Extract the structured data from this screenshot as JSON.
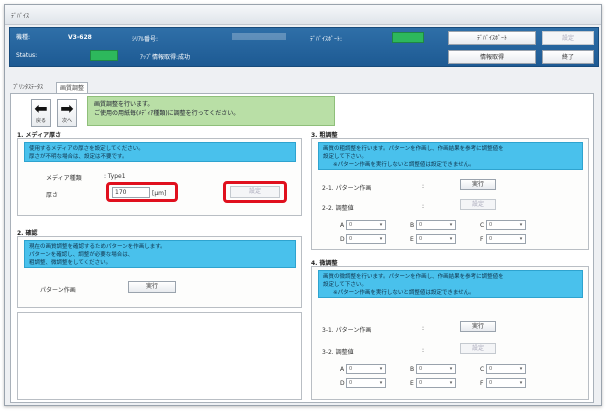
{
  "window": {
    "title": "ﾃﾞﾊﾞｲｽ"
  },
  "info": {
    "model_label": "機種:",
    "model_value": "V3-628",
    "serial_label": "ｼﾘｱﾙ番号:",
    "serial_value": "",
    "connection_label": "ﾃﾞﾊﾞｲｽﾎﾟｰﾄ:",
    "status_label": "Status:",
    "status_text": "ｱｯﾌﾟ情報取得:成功",
    "btn_device_port": "ﾃﾞﾊﾞｲｽﾎﾟｰﾄ",
    "btn_settings": "設定",
    "btn_info": "情報取得",
    "btn_exit": "終了"
  },
  "tabs": [
    {
      "label": "ﾌﾟﾘﾝﾀｽﾃｰﾀｽ"
    },
    {
      "label": "画質調整"
    }
  ],
  "nav": {
    "prev": "戻る",
    "next": "次へ"
  },
  "intro": {
    "line1": "画質調整を行います。",
    "line2": "ご使用の用紙毎(ﾒﾃﾞｨｱ種類)に調整を行ってください。"
  },
  "sec1": {
    "title": "1. メディア厚さ",
    "desc1": "使用するメディアの厚さを設定してください。",
    "desc2": "厚さが不明な場合は、設定は不要です。",
    "media_label": "メディア種類",
    "media_value": ": Type1",
    "thickness_label": "厚さ",
    "thickness_value": "170",
    "unit": "[μm]",
    "set_button": "設定"
  },
  "sec2": {
    "title": "2. 確認",
    "desc1": "現在の画質調整を確認するためパターンを作画します。",
    "desc2": "パターンを確認し、調整が必要な場合は、",
    "desc3": "粗調整、微調整をしてください。",
    "pattern_label": "パターン作画",
    "run_button": "実行"
  },
  "sec3": {
    "title": "3. 粗調整",
    "desc1": "画質の粗調整を行います。パターンを作画し、作画結果を参考に調整値を",
    "desc2": "設定して下さい。",
    "desc3": "※パターン作画を実行しないと調整値は設定できません。",
    "step1_label": "2-1. パターン作画",
    "step1_button": "実行",
    "step2_label": "2-2. 調整値",
    "step2_button": "設定",
    "selects": [
      {
        "label": "A",
        "value": "0"
      },
      {
        "label": "B",
        "value": "0"
      },
      {
        "label": "C",
        "value": "0"
      },
      {
        "label": "D",
        "value": "0"
      },
      {
        "label": "E",
        "value": "0"
      },
      {
        "label": "F",
        "value": "0"
      }
    ]
  },
  "sec4": {
    "title": "4. 微調整",
    "desc1": "画質の微調整を行います。パターンを作画し、作画結果を参考に調整値を",
    "desc2": "設定して下さい。",
    "desc3": "※パターン作画を実行しないと調整値は設定できません。",
    "step1_label": "3-1. パターン作画",
    "step1_button": "実行",
    "step2_label": "3-2. 調整値",
    "step2_button": "設定",
    "selects": [
      {
        "label": "A",
        "value": "0"
      },
      {
        "label": "B",
        "value": "0"
      },
      {
        "label": "C",
        "value": "0"
      },
      {
        "label": "D",
        "value": "0"
      },
      {
        "label": "E",
        "value": "0"
      },
      {
        "label": "F",
        "value": "0"
      }
    ]
  },
  "colors": {
    "accent": "#1d5a93",
    "status_ok": "#2db85c",
    "info_box": "#49c1ec",
    "highlight": "#e0101e"
  }
}
